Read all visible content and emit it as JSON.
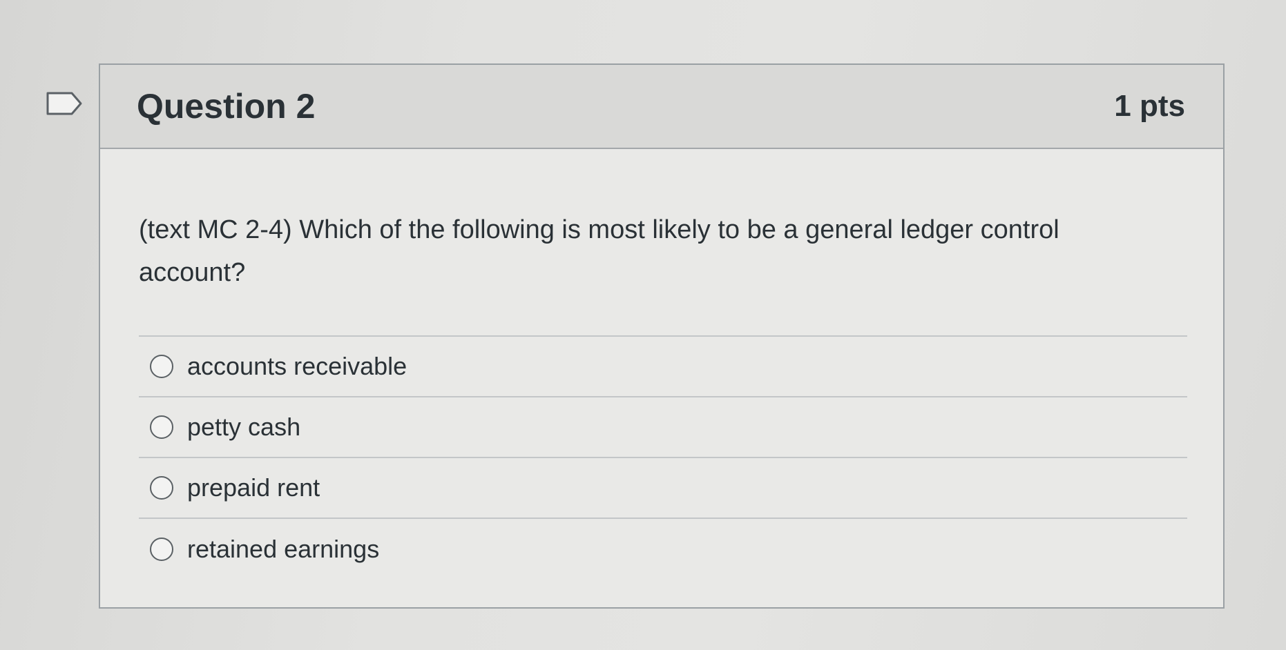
{
  "question": {
    "title": "Question 2",
    "points": "1 pts",
    "text": "(text MC 2-4)  Which of the following is most likely to be a general ledger control account?",
    "flag_icon": "flag-tab-icon",
    "answers": [
      {
        "label": "accounts receivable",
        "selected": false
      },
      {
        "label": "petty cash",
        "selected": false
      },
      {
        "label": "prepaid rent",
        "selected": false
      },
      {
        "label": "retained earnings",
        "selected": false
      }
    ]
  },
  "colors": {
    "header_bg": "#d9d9d7",
    "card_bg": "#e9e9e7",
    "border": "#9aa0a4",
    "text": "#2a3136"
  }
}
